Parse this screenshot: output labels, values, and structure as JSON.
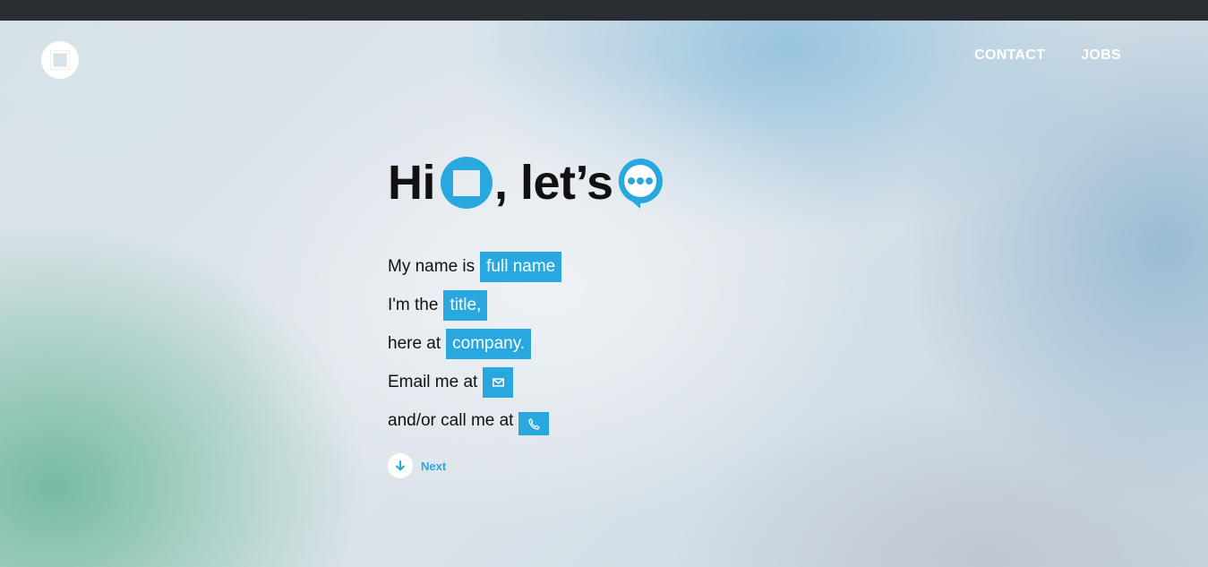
{
  "nav": {
    "items": [
      {
        "label": "CONTACT"
      },
      {
        "label": "JOBS"
      }
    ]
  },
  "heading": {
    "hi": "Hi",
    "middle": ", let’s"
  },
  "form": {
    "name_label": "My name is",
    "name_placeholder": "full name",
    "title_label": "I'm the",
    "title_placeholder": "title,",
    "company_label": "here at",
    "company_placeholder": "company.",
    "email_label": "Email me at",
    "email_icon": "envelope-icon",
    "phone_label": "and/or call me at",
    "phone_icon": "phone-icon"
  },
  "next": {
    "label": "Next",
    "icon": "arrow-down-icon"
  },
  "colors": {
    "accent": "#29a8e0",
    "topbar": "#2a2d31",
    "text": "#111111"
  }
}
